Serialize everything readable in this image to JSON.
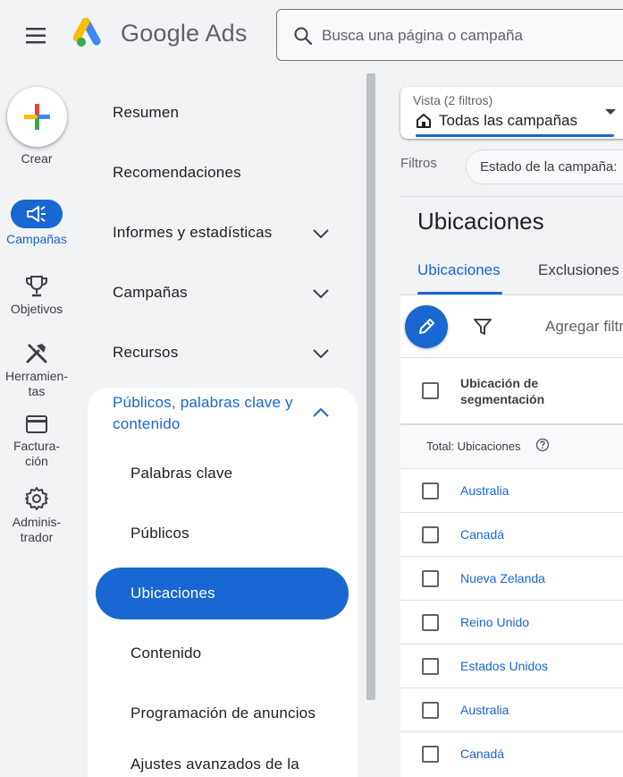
{
  "header": {
    "brand": "Google Ads",
    "search_placeholder": "Busca una página o campaña"
  },
  "rail": {
    "create_label": "Crear",
    "items": [
      {
        "label": "Campañas",
        "active": true
      },
      {
        "label": "Objetivos"
      },
      {
        "label": "Herramien-\ntas"
      },
      {
        "label": "Factura-\nción"
      },
      {
        "label": "Adminis-\ntrador"
      }
    ]
  },
  "nav": {
    "items": [
      "Resumen",
      "Recomendaciones",
      "Informes y estadísticas",
      "Campañas",
      "Recursos"
    ],
    "section_title": "Públicos, palabras clave y contenido",
    "sub_items": [
      "Palabras clave",
      "Públicos",
      "Ubicaciones",
      "Contenido",
      "Programación de anuncios",
      "Ajustes avanzados de la"
    ],
    "active_sub": "Ubicaciones"
  },
  "view": {
    "label": "Vista (2 filtros)",
    "value": "Todas las campañas"
  },
  "filters": {
    "label": "Filtros",
    "chip": "Estado de la campaña:"
  },
  "page": {
    "title": "Ubicaciones",
    "tabs": [
      "Ubicaciones",
      "Exclusiones"
    ],
    "add_filter": "Agregar filtro"
  },
  "table": {
    "header": "Ubicación de segmentación",
    "total_label": "Total: Ubicaciones",
    "rows": [
      "Australia",
      "Canadá",
      "Nueva Zelanda",
      "Reino Unido",
      "Estados Unidos",
      "Australia",
      "Canadá"
    ]
  },
  "colors": {
    "accent": "#1967d2",
    "background": "#f1f3f4"
  }
}
